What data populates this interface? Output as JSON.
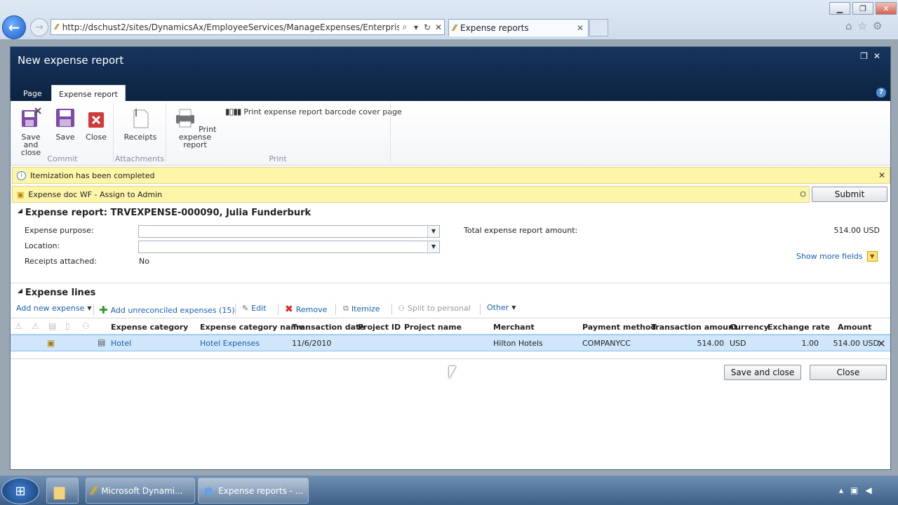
{
  "browser": {
    "url": "http://dschust2/sites/DynamicsAx/EmployeeServices/ManageExpenses/Enterprise%20Po",
    "tab_title": "Expense reports",
    "search_glyph": "⌕",
    "refresh_glyph": "↻",
    "stop_glyph": "✕"
  },
  "dialog": {
    "title": "New expense report",
    "ribbon_tabs": [
      "Page",
      "Expense report"
    ],
    "ribbon": {
      "save_and_close": "Save and close",
      "save": "Save",
      "close": "Close",
      "receipts": "Receipts",
      "print_report": "Print expense report",
      "print_barcode": "Print expense report barcode cover page",
      "group_commit": "Commit",
      "group_attachments": "Attachments",
      "group_print": "Print"
    },
    "info_message": "Itemization has been completed",
    "workflow_message": "Expense doc WF - Assign to Admin",
    "submit_label": "Submit",
    "header_section_title": "Expense report: TRVEXPENSE-000090, Julia Funderburk",
    "fields": {
      "purpose_label": "Expense purpose:",
      "purpose_value": "",
      "location_label": "Location:",
      "location_value": "",
      "receipts_label": "Receipts attached:",
      "receipts_value": "No",
      "total_label": "Total expense report amount:",
      "total_value": "514.00 USD",
      "show_more": "Show more fields"
    },
    "lines_section_title": "Expense lines",
    "toolbar": {
      "add_new": "Add new expense",
      "add_unreconciled": "Add unreconciled expenses (15)",
      "edit": "Edit",
      "remove": "Remove",
      "itemize": "Itemize",
      "split": "Split to personal",
      "other": "Other"
    },
    "columns": [
      "Expense category",
      "Expense category name",
      "Transaction date",
      "Project ID",
      "Project name",
      "Merchant",
      "Payment method",
      "Transaction amount",
      "Currency",
      "Exchange rate",
      "Amount"
    ],
    "rows": [
      {
        "category": "Hotel",
        "category_name": "Hotel Expenses",
        "date": "11/6/2010",
        "project_id": "",
        "project_name": "",
        "merchant": "Hilton Hotels",
        "payment": "COMPANYCC",
        "trans_amount": "514.00",
        "currency": "USD",
        "rate": "1.00",
        "amount": "514.00 USD"
      }
    ],
    "save_close_button": "Save and close",
    "close_button": "Close"
  },
  "taskbar": {
    "items": [
      "Microsoft Dynami...",
      "Expense reports - ..."
    ]
  },
  "colors": {
    "accent": "#1b5fb1",
    "title_bar": "#0c2340",
    "info_bar": "#fdf5a8",
    "selected_row": "#cfe6fb"
  }
}
